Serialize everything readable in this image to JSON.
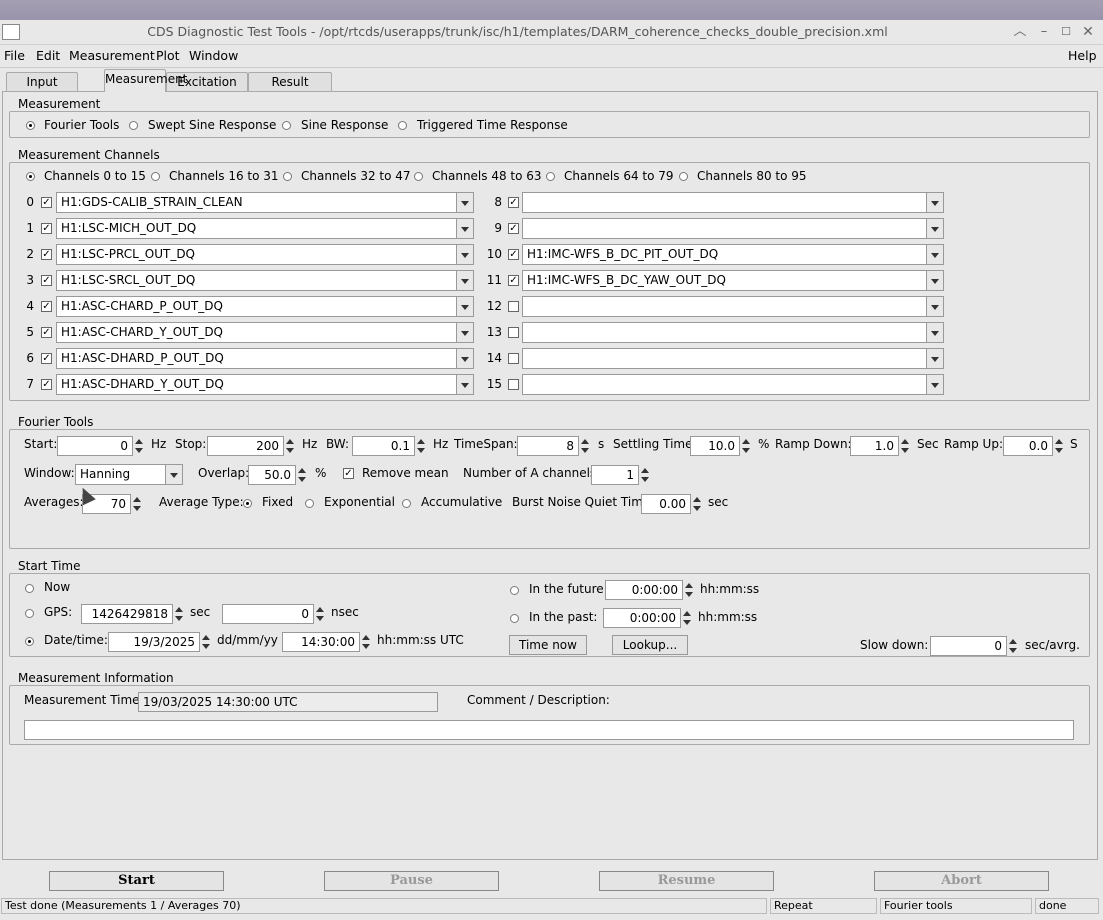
{
  "window": {
    "title": "CDS Diagnostic Test Tools - /opt/rtcds/userapps/trunk/isc/h1/templates/DARM_coherence_checks_double_precision.xml"
  },
  "menu": {
    "file": "File",
    "edit": "Edit",
    "measurement": "Measurement",
    "plot": "Plot",
    "window": "Window",
    "help": "Help"
  },
  "tabs": [
    "Input",
    "Measurement",
    "Excitation",
    "Result"
  ],
  "measurement": {
    "label": "Measurement",
    "options": [
      "Fourier Tools",
      "Swept Sine Response",
      "Sine Response",
      "Triggered Time Response"
    ],
    "selected": "Fourier Tools"
  },
  "channels": {
    "label": "Measurement Channels",
    "ranges": [
      "Channels 0 to 15",
      "Channels 16 to 31",
      "Channels 32 to 47",
      "Channels 48 to 63",
      "Channels 64 to 79",
      "Channels 80 to 95"
    ],
    "selected_range": "Channels 0 to 15",
    "left": [
      {
        "n": "0",
        "checked": true,
        "name": "H1:GDS-CALIB_STRAIN_CLEAN"
      },
      {
        "n": "1",
        "checked": true,
        "name": "H1:LSC-MICH_OUT_DQ"
      },
      {
        "n": "2",
        "checked": true,
        "name": "H1:LSC-PRCL_OUT_DQ"
      },
      {
        "n": "3",
        "checked": true,
        "name": "H1:LSC-SRCL_OUT_DQ"
      },
      {
        "n": "4",
        "checked": true,
        "name": "H1:ASC-CHARD_P_OUT_DQ"
      },
      {
        "n": "5",
        "checked": true,
        "name": "H1:ASC-CHARD_Y_OUT_DQ"
      },
      {
        "n": "6",
        "checked": true,
        "name": "H1:ASC-DHARD_P_OUT_DQ"
      },
      {
        "n": "7",
        "checked": true,
        "name": "H1:ASC-DHARD_Y_OUT_DQ"
      }
    ],
    "right": [
      {
        "n": "8",
        "checked": true,
        "name": ""
      },
      {
        "n": "9",
        "checked": true,
        "name": ""
      },
      {
        "n": "10",
        "checked": true,
        "name": "H1:IMC-WFS_B_DC_PIT_OUT_DQ"
      },
      {
        "n": "11",
        "checked": true,
        "name": "H1:IMC-WFS_B_DC_YAW_OUT_DQ"
      },
      {
        "n": "12",
        "checked": false,
        "name": ""
      },
      {
        "n": "13",
        "checked": false,
        "name": ""
      },
      {
        "n": "14",
        "checked": false,
        "name": ""
      },
      {
        "n": "15",
        "checked": false,
        "name": ""
      }
    ]
  },
  "fourier": {
    "label": "Fourier Tools",
    "start_label": "Start:",
    "start": "0",
    "hz1": "Hz",
    "stop_label": "Stop:",
    "stop": "200",
    "hz2": "Hz",
    "bw_label": "BW:",
    "bw": "0.1",
    "hz3": "Hz",
    "timespan_label": "TimeSpan:",
    "timespan": "8",
    "s": "s",
    "settling_label": "Settling Time:",
    "settling": "10.0",
    "pct": "%",
    "rampdown_label": "Ramp Down:",
    "rampdown": "1.0",
    "sec": "Sec",
    "rampup_label": "Ramp Up:",
    "rampup": "0.0",
    "rampup_unit": "S",
    "window_label": "Window:",
    "window": "Hanning",
    "overlap_label": "Overlap:",
    "overlap": "50.0",
    "pct2": "%",
    "remove_mean": "Remove mean",
    "remove_mean_checked": true,
    "num_a_label": "Number of A channels:",
    "num_a": "1",
    "averages_label": "Averages:",
    "averages": "70",
    "avg_type_label": "Average Type:",
    "avg_types": [
      "Fixed",
      "Exponential",
      "Accumulative"
    ],
    "avg_type_selected": "Fixed",
    "burst_label": "Burst Noise Quiet Time",
    "burst": "0.00",
    "burst_unit": "sec"
  },
  "start_time": {
    "label": "Start Time",
    "now": "Now",
    "gps_label": "GPS:",
    "gps": "1426429818",
    "gps_unit": "sec",
    "nsec": "0",
    "nsec_unit": "nsec",
    "datetime_label": "Date/time:",
    "date": "19/3/2025",
    "date_unit": "dd/mm/yy",
    "time": "14:30:00",
    "time_unit": "hh:mm:ss  UTC",
    "selected": "Date/time",
    "future_label": "In the future:",
    "future": "0:00:00",
    "future_unit": "hh:mm:ss",
    "past_label": "In the past:",
    "past": "0:00:00",
    "past_unit": "hh:mm:ss",
    "time_now_btn": "Time now",
    "lookup_btn": "Lookup...",
    "slowdown_label": "Slow down:",
    "slowdown": "0",
    "slowdown_unit": "sec/avrg."
  },
  "info": {
    "label": "Measurement Information",
    "mtime_label": "Measurement Time:",
    "mtime": "19/03/2025 14:30:00  UTC",
    "comment_label": "Comment / Description:",
    "comment": ""
  },
  "buttons": {
    "start": "Start",
    "pause": "Pause",
    "resume": "Resume",
    "abort": "Abort"
  },
  "status": {
    "main": "Test done (Measurements 1 / Averages 70)",
    "repeat": "Repeat",
    "mode": "Fourier tools",
    "state": "done"
  }
}
